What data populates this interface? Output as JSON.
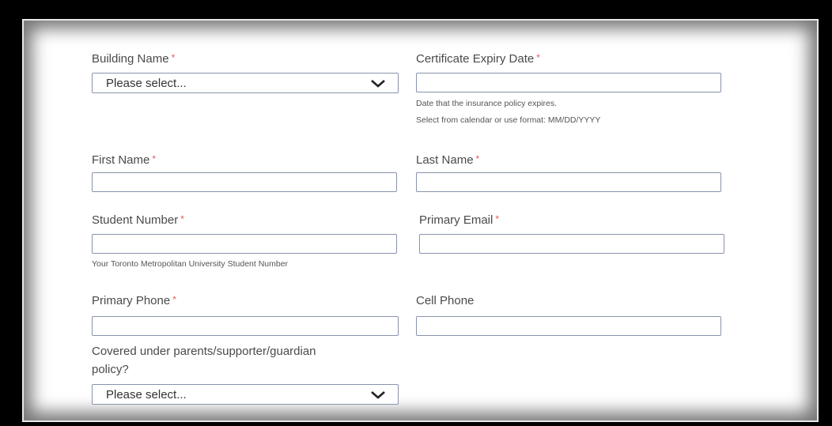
{
  "form": {
    "building_name": {
      "label": "Building Name",
      "required_mark": "*",
      "value": "Please select..."
    },
    "certificate_expiry": {
      "label": "Certificate Expiry Date",
      "required_mark": "*",
      "value": "",
      "help1": "Date that the insurance policy expires.",
      "help2": "Select from calendar or use format: MM/DD/YYYY"
    },
    "first_name": {
      "label": "First Name",
      "required_mark": "*",
      "value": ""
    },
    "last_name": {
      "label": "Last Name",
      "required_mark": "*",
      "value": ""
    },
    "student_number": {
      "label": "Student Number",
      "required_mark": "*",
      "value": "",
      "help": "Your Toronto Metropolitan University Student Number"
    },
    "primary_email": {
      "label": "Primary Email",
      "required_mark": "*",
      "value": ""
    },
    "primary_phone": {
      "label": "Primary Phone",
      "required_mark": "*",
      "value": ""
    },
    "cell_phone": {
      "label": "Cell Phone",
      "value": ""
    },
    "covered_policy": {
      "label_line1": "Covered under parents/supporter/guardian",
      "label_line2": "policy?",
      "value": "Please select..."
    }
  },
  "icons": {
    "select_arrow": "chevron-down-icon"
  },
  "colors": {
    "required": "#e05a5a",
    "input_border": "#8a93ad",
    "frame": "#000000"
  }
}
